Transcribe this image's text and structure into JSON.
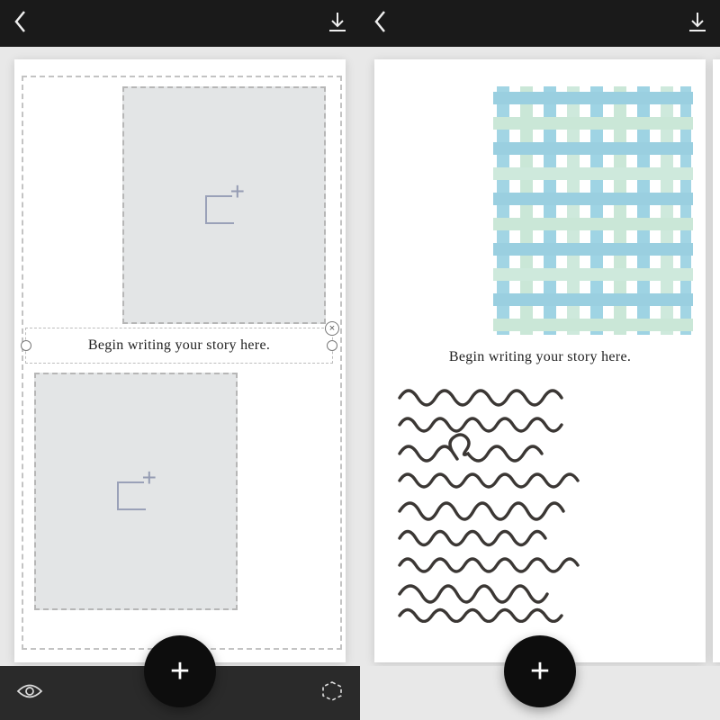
{
  "topbar": {
    "back": "‹",
    "download": "↓"
  },
  "left_panel": {
    "placeholder_text": "Begin writing your story here.",
    "delete_handle": "×",
    "add_icon_plus": "+"
  },
  "right_panel": {
    "caption": "Begin writing your story here."
  },
  "bottombar": {
    "add": "+"
  }
}
